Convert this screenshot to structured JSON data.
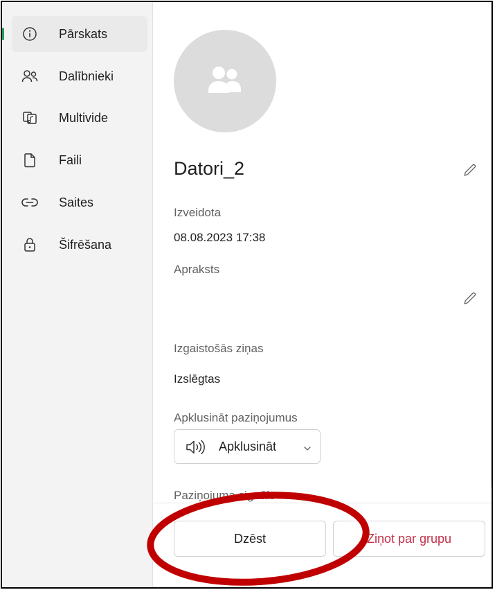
{
  "sidebar": {
    "items": [
      {
        "label": "Pārskats",
        "icon": "info-icon",
        "active": true
      },
      {
        "label": "Dalībnieki",
        "icon": "people-icon",
        "active": false
      },
      {
        "label": "Multivide",
        "icon": "media-icon",
        "active": false
      },
      {
        "label": "Faili",
        "icon": "file-icon",
        "active": false
      },
      {
        "label": "Saites",
        "icon": "link-icon",
        "active": false
      },
      {
        "label": "Šifrēšana",
        "icon": "lock-icon",
        "active": false
      }
    ]
  },
  "group": {
    "name": "Datori_2",
    "created_label": "Izveidota",
    "created_value": "08.08.2023 17:38",
    "description_label": "Apraksts",
    "disappearing_label": "Izgaistošās ziņas",
    "disappearing_value": "Izslēgtas",
    "mute_label": "Apklusināt paziņojumus",
    "mute_dropdown": "Apklusināt",
    "sound_label": "Paziņojuma signāls"
  },
  "actions": {
    "delete_label": "Dzēst",
    "report_label": "Ziņot par grupu"
  },
  "colors": {
    "accent_green": "#2b9a57",
    "danger_red": "#c4314b",
    "annotation_red": "#c00000"
  }
}
